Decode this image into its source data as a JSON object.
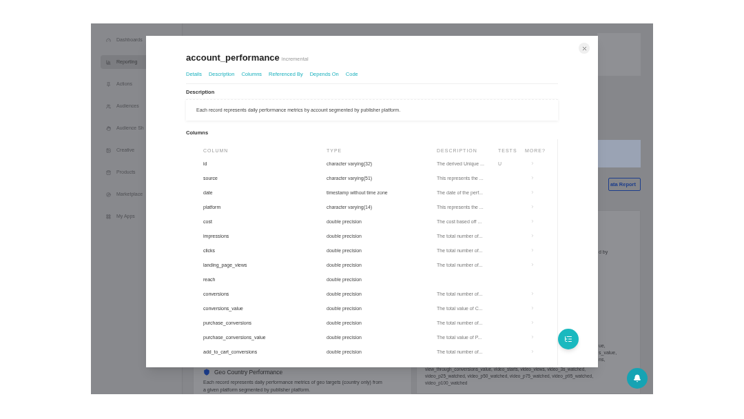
{
  "sidebar": {
    "items": [
      {
        "label": "Dashboards",
        "selected": false
      },
      {
        "label": "Reporting",
        "selected": true
      },
      {
        "label": "Actions",
        "selected": false
      },
      {
        "label": "Audiences",
        "selected": false
      },
      {
        "label": "Audience Sh",
        "selected": false
      },
      {
        "label": "Creative",
        "selected": false
      },
      {
        "label": "Products",
        "selected": false
      },
      {
        "label": "Marketplace",
        "selected": false
      },
      {
        "label": "My Apps",
        "selected": false
      }
    ]
  },
  "background": {
    "report_button": "ata Report",
    "card_fragments": [
      "d by",
      "ue,",
      "s_value,",
      "ns,"
    ],
    "field_list": "view_through_conversions_value, video_starts, video_views, video_3s_watched, video_p25_watched, video_p50_watched, video_p75_watched, video_p95_watched, video_p100_watched",
    "geo_card": {
      "title": "Geo Country Performance",
      "description": "Each record represents daily performance metrics of geo targets (country only) from a given platform segmented by publisher platform."
    }
  },
  "modal": {
    "title": "account_performance",
    "badge": "incremental",
    "tabs": [
      "Details",
      "Description",
      "Columns",
      "Referenced By",
      "Depends On",
      "Code"
    ],
    "description_heading": "Description",
    "description": "Each record represents daily performance metrics by account segmented by publisher platform.",
    "columns_heading": "Columns",
    "table": {
      "columns": [
        "COLUMN",
        "TYPE",
        "DESCRIPTION",
        "TESTS",
        "MORE?"
      ],
      "rows": [
        {
          "column": "id",
          "type": "character varying(32)",
          "description": "The derived Unique ...",
          "tests": "U",
          "more": true
        },
        {
          "column": "source",
          "type": "character varying(51)",
          "description": "This represents the ...",
          "more": true
        },
        {
          "column": "date",
          "type": "timestamp without time zone",
          "description": "The date of the perf...",
          "more": true
        },
        {
          "column": "platform",
          "type": "character varying(14)",
          "description": "This represents the ...",
          "more": true
        },
        {
          "column": "cost",
          "type": "double precision",
          "description": "The cost based off ...",
          "more": true
        },
        {
          "column": "impressions",
          "type": "double precision",
          "description": "The total number of...",
          "more": true
        },
        {
          "column": "clicks",
          "type": "double precision",
          "description": "The total number of...",
          "more": true
        },
        {
          "column": "landing_page_views",
          "type": "double precision",
          "description": "The total number of...",
          "more": true
        },
        {
          "column": "reach",
          "type": "double precision",
          "more": false
        },
        {
          "column": "conversions",
          "type": "double precision",
          "description": "The total number of...",
          "more": true
        },
        {
          "column": "conversions_value",
          "type": "double precision",
          "description": "The total value of C...",
          "more": true
        },
        {
          "column": "purchase_conversions",
          "type": "double precision",
          "description": "The total number of...",
          "more": true
        },
        {
          "column": "purchase_conversions_value",
          "type": "double precision",
          "description": "The total value of P...",
          "more": true
        },
        {
          "column": "add_to_cart_conversions",
          "type": "double precision",
          "description": "The total number of...",
          "more": true
        }
      ]
    }
  }
}
